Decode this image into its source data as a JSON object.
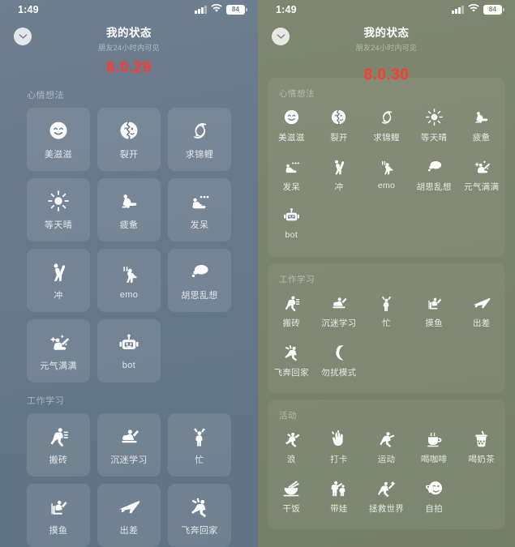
{
  "left": {
    "status_bar": {
      "time": "1:49",
      "battery": "84",
      "signal_icon": "cellular-signal-icon",
      "wifi_icon": "wifi-icon",
      "battery_icon": "battery-icon"
    },
    "header": {
      "title": "我的状态",
      "subtitle": "朋友24小时内可见",
      "close_icon": "chevron-down-icon"
    },
    "version": "8.0.29",
    "sections": [
      {
        "title": "心情想法",
        "items": [
          {
            "label": "美滋滋",
            "icon": "smiling-face-icon"
          },
          {
            "label": "裂开",
            "icon": "cracked-face-icon"
          },
          {
            "label": "求锦鲤",
            "icon": "koi-fish-icon"
          },
          {
            "label": "等天晴",
            "icon": "sun-icon"
          },
          {
            "label": "疲惫",
            "icon": "tired-person-icon"
          },
          {
            "label": "发呆",
            "icon": "daydreaming-person-icon"
          },
          {
            "label": "冲",
            "icon": "cheering-person-icon"
          },
          {
            "label": "emo",
            "icon": "emo-person-icon"
          },
          {
            "label": "胡思乱想",
            "icon": "thought-cloud-icon"
          },
          {
            "label": "元气满满",
            "icon": "energetic-person-icon"
          },
          {
            "label": "bot",
            "icon": "robot-icon"
          }
        ]
      },
      {
        "title": "工作学习",
        "items": [
          {
            "label": "搬砖",
            "icon": "carrying-bricks-icon"
          },
          {
            "label": "沉迷学习",
            "icon": "studying-person-icon"
          },
          {
            "label": "忙",
            "icon": "busy-person-icon"
          },
          {
            "label": "摸鱼",
            "icon": "slacking-person-icon"
          },
          {
            "label": "出差",
            "icon": "airplane-icon"
          },
          {
            "label": "飞奔回家",
            "icon": "running-home-icon"
          }
        ]
      }
    ]
  },
  "right": {
    "status_bar": {
      "time": "1:49",
      "battery": "84",
      "signal_icon": "cellular-signal-icon",
      "wifi_icon": "wifi-icon",
      "battery_icon": "battery-icon"
    },
    "header": {
      "title": "我的状态",
      "subtitle": "朋友24小时内可见",
      "close_icon": "chevron-down-icon"
    },
    "version": "8.0.30",
    "sections": [
      {
        "title": "心情想法",
        "items": [
          {
            "label": "美滋滋",
            "icon": "smiling-face-icon"
          },
          {
            "label": "裂开",
            "icon": "cracked-face-icon"
          },
          {
            "label": "求锦鲤",
            "icon": "koi-fish-icon"
          },
          {
            "label": "等天晴",
            "icon": "sun-icon"
          },
          {
            "label": "疲惫",
            "icon": "tired-person-icon"
          },
          {
            "label": "发呆",
            "icon": "daydreaming-person-icon"
          },
          {
            "label": "冲",
            "icon": "cheering-person-icon"
          },
          {
            "label": "emo",
            "icon": "emo-person-icon"
          },
          {
            "label": "胡思乱想",
            "icon": "thought-cloud-icon"
          },
          {
            "label": "元气满满",
            "icon": "energetic-person-icon"
          },
          {
            "label": "bot",
            "icon": "robot-icon"
          }
        ]
      },
      {
        "title": "工作学习",
        "items": [
          {
            "label": "搬砖",
            "icon": "carrying-bricks-icon"
          },
          {
            "label": "沉迷学习",
            "icon": "studying-person-icon"
          },
          {
            "label": "忙",
            "icon": "busy-person-icon"
          },
          {
            "label": "摸鱼",
            "icon": "slacking-person-icon"
          },
          {
            "label": "出差",
            "icon": "airplane-icon"
          },
          {
            "label": "飞奔回家",
            "icon": "running-home-icon"
          },
          {
            "label": "勿扰模式",
            "icon": "moon-icon"
          }
        ]
      },
      {
        "title": "活动",
        "items": [
          {
            "label": "浪",
            "icon": "dancing-person-icon"
          },
          {
            "label": "打卡",
            "icon": "peace-hand-icon"
          },
          {
            "label": "运动",
            "icon": "running-person-icon"
          },
          {
            "label": "喝咖啡",
            "icon": "coffee-cup-icon"
          },
          {
            "label": "喝奶茶",
            "icon": "bubble-tea-icon"
          },
          {
            "label": "干饭",
            "icon": "rice-bowl-icon"
          },
          {
            "label": "带娃",
            "icon": "parent-child-icon"
          },
          {
            "label": "拯救世界",
            "icon": "superhero-icon"
          },
          {
            "label": "自拍",
            "icon": "selfie-icon"
          }
        ]
      }
    ]
  },
  "colors": {
    "left_background": "#68798b",
    "right_background": "#7b846d",
    "version_text": "#ff3b30",
    "icon": "#ffffff"
  }
}
